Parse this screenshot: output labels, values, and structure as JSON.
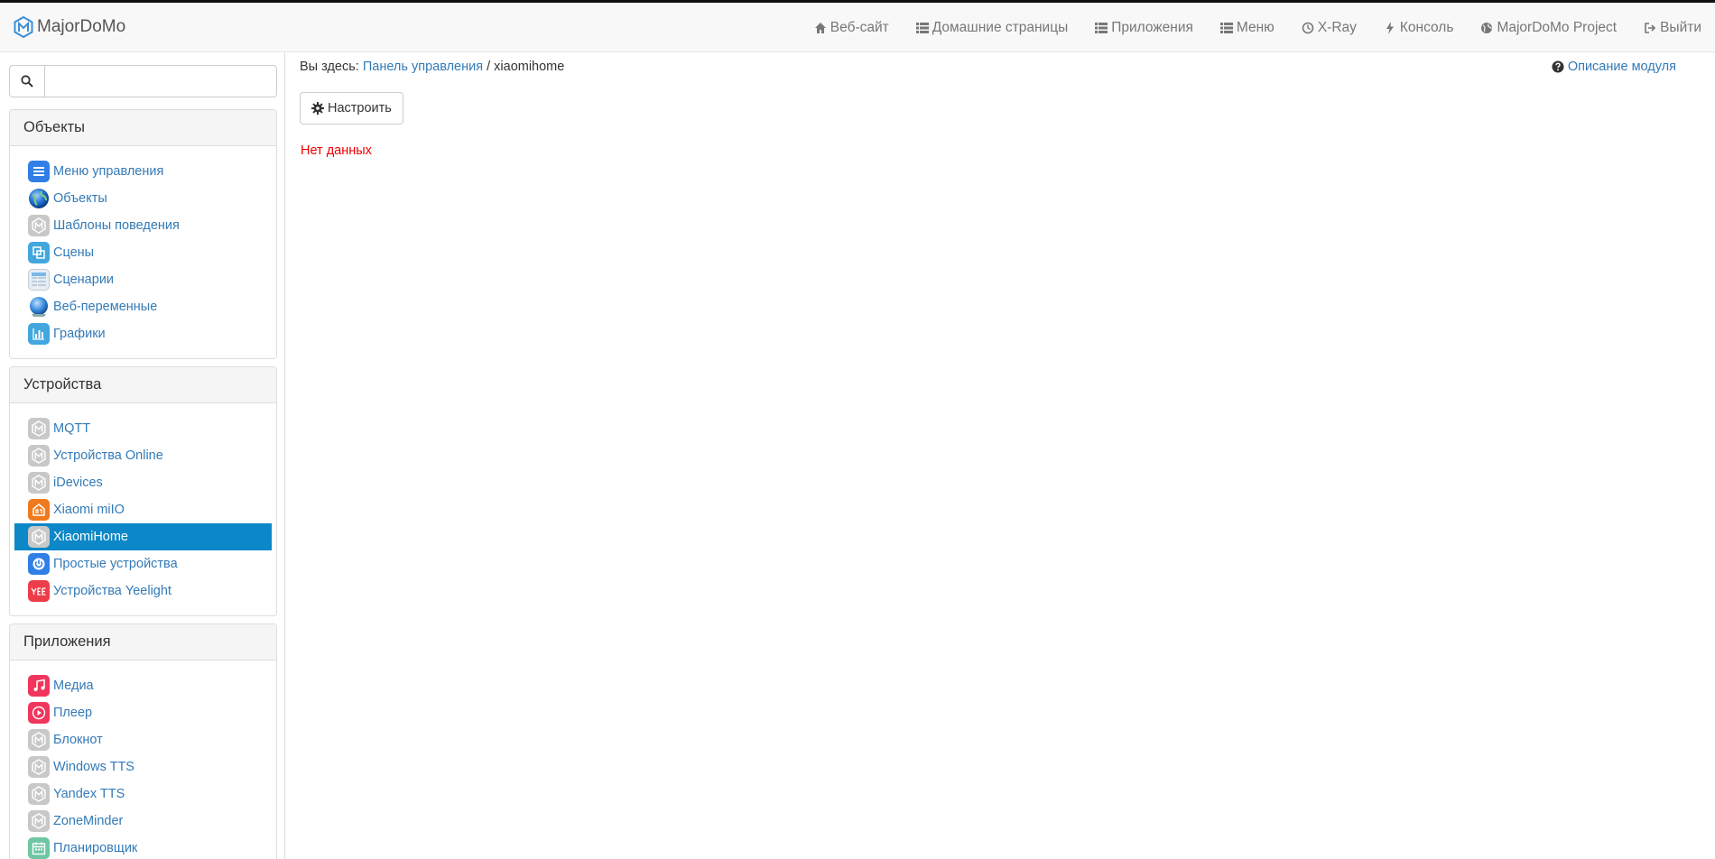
{
  "brand": {
    "name": "MajorDoMo"
  },
  "nav": [
    {
      "label": "Веб-сайт",
      "icon": "home-icon"
    },
    {
      "label": "Домашние страницы",
      "icon": "list-icon"
    },
    {
      "label": "Приложения",
      "icon": "list-icon"
    },
    {
      "label": "Меню",
      "icon": "list-icon"
    },
    {
      "label": "X-Ray",
      "icon": "clock-icon"
    },
    {
      "label": "Консоль",
      "icon": "bolt-icon"
    },
    {
      "label": "MajorDoMo Project",
      "icon": "globe-icon"
    },
    {
      "label": "Выйти",
      "icon": "logout-icon"
    }
  ],
  "search": {
    "value": "",
    "placeholder": ""
  },
  "sidebar": {
    "objects": {
      "title": "Объекты",
      "items": [
        {
          "label": "Меню управления",
          "icon": "menu-icon"
        },
        {
          "label": "Объекты",
          "icon": "globe-icon"
        },
        {
          "label": "Шаблоны поведения",
          "icon": "module-icon"
        },
        {
          "label": "Сцены",
          "icon": "scenes-icon"
        },
        {
          "label": "Сценарии",
          "icon": "table-icon"
        },
        {
          "label": "Веб-переменные",
          "icon": "globe-icon"
        },
        {
          "label": "Графики",
          "icon": "chart-icon"
        }
      ]
    },
    "devices": {
      "title": "Устройства",
      "items": [
        {
          "label": "MQTT",
          "icon": "module-icon"
        },
        {
          "label": "Устройства Online",
          "icon": "module-icon"
        },
        {
          "label": "iDevices",
          "icon": "module-icon"
        },
        {
          "label": "Xiaomi miIO",
          "icon": "mi-home-icon"
        },
        {
          "label": "XiaomiHome",
          "icon": "module-icon",
          "active": true
        },
        {
          "label": "Простые устройства",
          "icon": "power-icon"
        },
        {
          "label": "Устройства Yeelight",
          "icon": "yeelight-icon"
        }
      ]
    },
    "apps": {
      "title": "Приложения",
      "items": [
        {
          "label": "Медиа",
          "icon": "music-icon"
        },
        {
          "label": "Плеер",
          "icon": "play-icon"
        },
        {
          "label": "Блокнот",
          "icon": "module-icon"
        },
        {
          "label": "Windows TTS",
          "icon": "module-icon"
        },
        {
          "label": "Yandex TTS",
          "icon": "module-icon"
        },
        {
          "label": "ZoneMinder",
          "icon": "module-icon"
        },
        {
          "label": "Планировщик",
          "icon": "calendar-icon"
        }
      ]
    }
  },
  "main": {
    "breadcrumb_prefix": "Вы здесь:",
    "breadcrumb_link": "Панель управления",
    "breadcrumb_sep": "/",
    "breadcrumb_current": "xiaomihome",
    "module_help": "Описание модуля",
    "setup_button": "Настроить",
    "no_data": "Нет данных"
  },
  "colors": {
    "link": "#337ab7",
    "active": "#0c87c7",
    "no_data": "#ee0000"
  }
}
